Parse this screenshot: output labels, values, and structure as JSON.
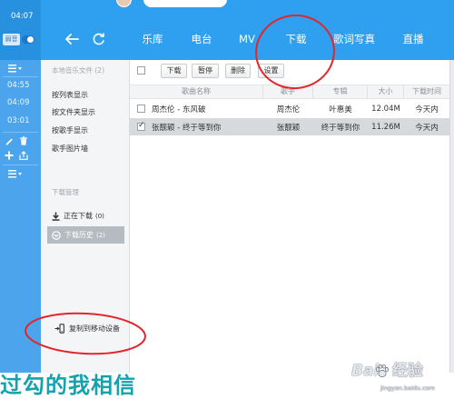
{
  "left_rail": {
    "clock": "04:07",
    "mute_toggle_label": "弱音",
    "durations": [
      "04:55",
      "04:09",
      "03:01"
    ],
    "icons": [
      "list-menu-icon",
      "edit-icon",
      "trash-icon",
      "add-icon",
      "export-icon"
    ]
  },
  "nav": {
    "icons": [
      "back-arrow-icon",
      "refresh-icon"
    ],
    "tabs": [
      {
        "label": "乐库",
        "active": false
      },
      {
        "label": "电台",
        "active": false
      },
      {
        "label": "MV",
        "active": false
      },
      {
        "label": "下载",
        "active": true
      },
      {
        "label": "歌词写真",
        "active": false
      },
      {
        "label": "直播",
        "active": false
      }
    ]
  },
  "sidebar": {
    "local_section_title": "本地音乐文件 (2)",
    "local_items": [
      "按列表显示",
      "按文件夹显示",
      "按歌手显示",
      "歌手图片墙"
    ],
    "download_section_title": "下载管理",
    "download_items": [
      {
        "label": "正在下载",
        "count": "(0)",
        "icon": "download-icon",
        "selected": false
      },
      {
        "label": "下载历史",
        "count": "(2)",
        "icon": "history-icon",
        "selected": true
      }
    ],
    "copy_to_device_label": "复制到移动设备",
    "copy_to_device_icon": "phone-transfer-icon"
  },
  "toolbar": {
    "select_all_checked": false,
    "buttons": [
      "下载",
      "暂停",
      "删除",
      "设置"
    ]
  },
  "table": {
    "columns": [
      "歌曲名称",
      "歌手",
      "专辑",
      "大小",
      "下载时间"
    ],
    "rows": [
      {
        "checked": false,
        "selected": false,
        "cells": [
          "周杰伦 - 东风破",
          "周杰伦",
          "叶惠美",
          "12.04M",
          "今天内"
        ]
      },
      {
        "checked": true,
        "selected": true,
        "cells": [
          "张靓颖 - 终于等到你",
          "张靓颖",
          "终于等到你",
          "11.26M",
          "今天内"
        ]
      }
    ]
  },
  "caption": "过勾的我相信",
  "watermark": {
    "brand": "Bai",
    "brand_suffix": "经验",
    "url": "jingyan.baidu.com",
    "icon": "paw-icon"
  },
  "colors": {
    "header_blue": "#2f9ff0",
    "rail_blue": "#4ba4ec",
    "selected_row": "#d7dadd",
    "sidebar_selected": "#b6bbc1",
    "annotation_red": "#e1262c",
    "caption_teal": "#14a2ad"
  }
}
